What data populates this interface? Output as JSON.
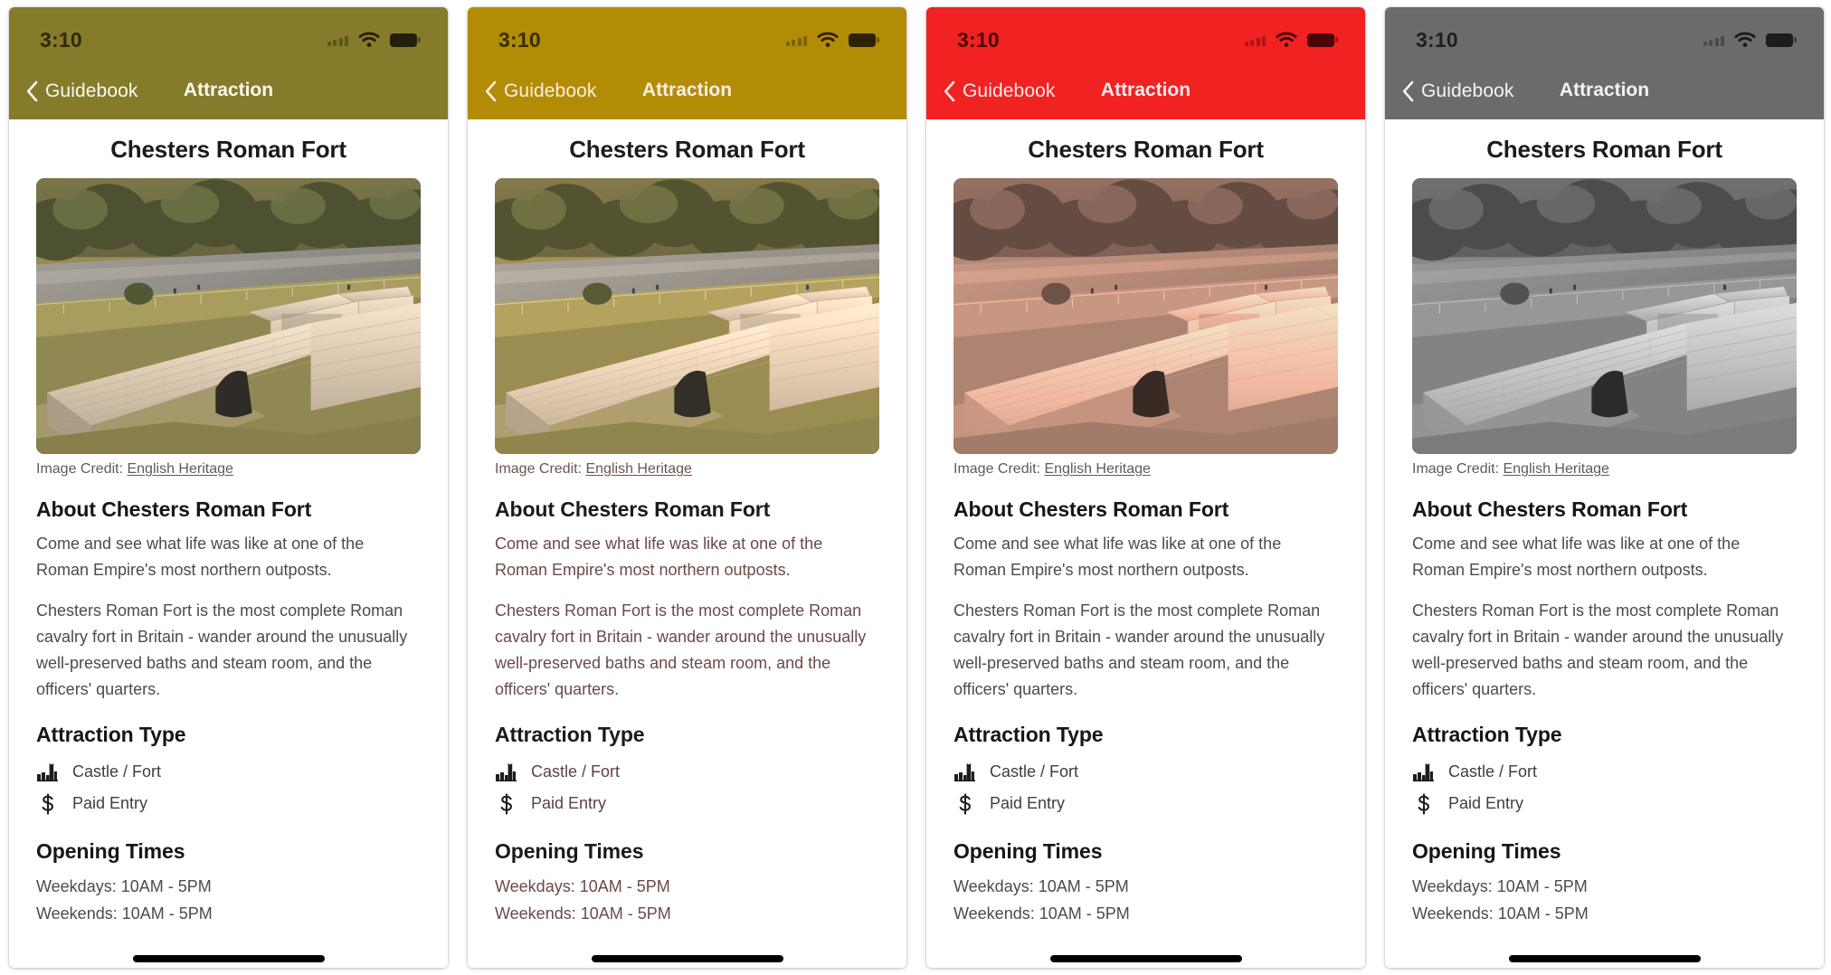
{
  "panels": [
    {
      "theme": "olive",
      "nav_bg": "#857b2b",
      "status": {
        "time": "3:10",
        "wifi": "wifi-icon",
        "battery": "battery-icon",
        "signal": "signal-dots-icon"
      },
      "nav": {
        "back_label": "Guidebook",
        "title": "Attraction"
      }
    },
    {
      "theme": "gold",
      "nav_bg": "#b38c06",
      "status": {
        "time": "3:10",
        "wifi": "wifi-icon",
        "battery": "battery-icon",
        "signal": "signal-dots-icon"
      },
      "nav": {
        "back_label": "Guidebook",
        "title": "Attraction"
      }
    },
    {
      "theme": "red",
      "nav_bg": "#f02222",
      "status": {
        "time": "3:10",
        "wifi": "wifi-icon",
        "battery": "battery-icon",
        "signal": "signal-dots-icon"
      },
      "nav": {
        "back_label": "Guidebook",
        "title": "Attraction"
      }
    },
    {
      "theme": "gray",
      "nav_bg": "#6b6b6b",
      "status": {
        "time": "3:10",
        "wifi": "wifi-icon",
        "battery": "battery-icon",
        "signal": "signal-dots-icon"
      },
      "nav": {
        "back_label": "Guidebook",
        "title": "Attraction"
      }
    }
  ],
  "screen": {
    "page_title": "Chesters Roman Fort",
    "photo_alt": "Aerial photograph of the stone ruins of Chesters Roman Fort beside a river",
    "credit_prefix": "Image Credit: ",
    "credit_link": "English Heritage",
    "about_heading": "About Chesters Roman Fort",
    "about_p1": "Come and see what life was like at one of the Roman Empire's most northern outposts.",
    "about_p2": "Chesters Roman Fort is the most complete Roman cavalry fort in Britain - wander around the unusually well-preserved baths and steam room, and the officers' quarters.",
    "type_heading": "Attraction Type",
    "types": [
      {
        "icon": "castle-fort-icon",
        "label": "Castle / Fort"
      },
      {
        "icon": "dollar-sign-icon",
        "label": "Paid Entry"
      }
    ],
    "times_heading": "Opening Times",
    "times": [
      "Weekdays: 10AM - 5PM",
      "Weekends: 10AM - 5PM"
    ]
  }
}
